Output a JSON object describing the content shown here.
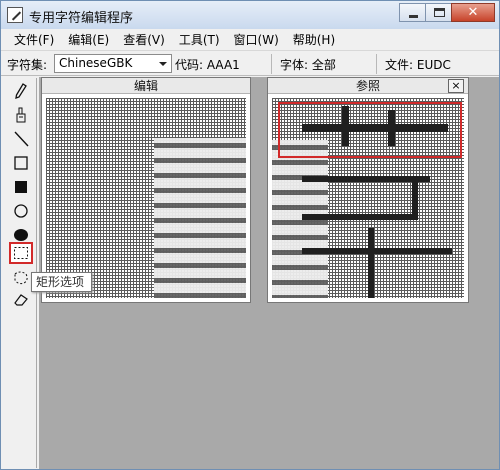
{
  "window": {
    "title": "专用字符编辑程序"
  },
  "menu": [
    "文件(F)",
    "编辑(E)",
    "查看(V)",
    "工具(T)",
    "窗口(W)",
    "帮助(H)"
  ],
  "toolbar": {
    "charset_label": "字符集:",
    "charset_value": "ChineseGBK",
    "code_label": "代码: AAA1",
    "font_label": "字体: 全部",
    "file_label": "文件: EUDC"
  },
  "tools": [
    {
      "name": "pencil-tool",
      "icon": "pencil-icon"
    },
    {
      "name": "brush-tool",
      "icon": "brush-icon"
    },
    {
      "name": "line-tool",
      "icon": "line-icon"
    },
    {
      "name": "hollow-rect-tool",
      "icon": "hollow-rectangle-icon"
    },
    {
      "name": "filled-rect-tool",
      "icon": "filled-rectangle-icon"
    },
    {
      "name": "hollow-ellipse-tool",
      "icon": "hollow-ellipse-icon"
    },
    {
      "name": "filled-ellipse-tool",
      "icon": "filled-ellipse-icon"
    },
    {
      "name": "rect-select-tool",
      "icon": "rectangle-select-icon"
    },
    {
      "name": "freeform-select-tool",
      "icon": "freeform-select-icon"
    },
    {
      "name": "eraser-tool",
      "icon": "eraser-icon"
    }
  ],
  "tooltip": {
    "text": "矩形选项"
  },
  "panes": {
    "edit_title": "编辑",
    "reference_title": "参照",
    "reference_close": "×"
  },
  "colors": {
    "selection_highlight": "#d22a2a",
    "workspace_bg": "#a9a9a9",
    "close_button": "#c7432a"
  }
}
